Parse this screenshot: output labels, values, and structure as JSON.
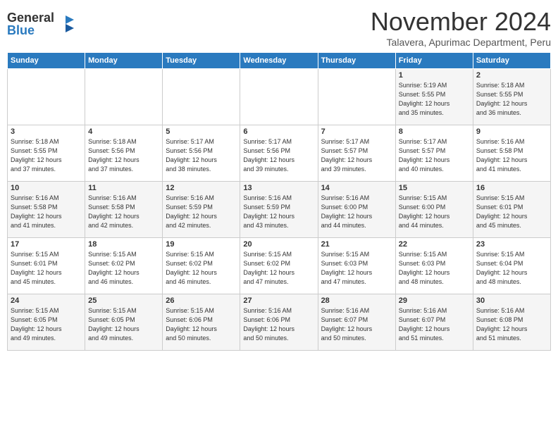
{
  "header": {
    "logo_general": "General",
    "logo_blue": "Blue",
    "month_title": "November 2024",
    "location": "Talavera, Apurimac Department, Peru"
  },
  "days_of_week": [
    "Sunday",
    "Monday",
    "Tuesday",
    "Wednesday",
    "Thursday",
    "Friday",
    "Saturday"
  ],
  "weeks": [
    [
      {
        "day": "",
        "info": ""
      },
      {
        "day": "",
        "info": ""
      },
      {
        "day": "",
        "info": ""
      },
      {
        "day": "",
        "info": ""
      },
      {
        "day": "",
        "info": ""
      },
      {
        "day": "1",
        "info": "Sunrise: 5:19 AM\nSunset: 5:55 PM\nDaylight: 12 hours\nand 35 minutes."
      },
      {
        "day": "2",
        "info": "Sunrise: 5:18 AM\nSunset: 5:55 PM\nDaylight: 12 hours\nand 36 minutes."
      }
    ],
    [
      {
        "day": "3",
        "info": "Sunrise: 5:18 AM\nSunset: 5:55 PM\nDaylight: 12 hours\nand 37 minutes."
      },
      {
        "day": "4",
        "info": "Sunrise: 5:18 AM\nSunset: 5:56 PM\nDaylight: 12 hours\nand 37 minutes."
      },
      {
        "day": "5",
        "info": "Sunrise: 5:17 AM\nSunset: 5:56 PM\nDaylight: 12 hours\nand 38 minutes."
      },
      {
        "day": "6",
        "info": "Sunrise: 5:17 AM\nSunset: 5:56 PM\nDaylight: 12 hours\nand 39 minutes."
      },
      {
        "day": "7",
        "info": "Sunrise: 5:17 AM\nSunset: 5:57 PM\nDaylight: 12 hours\nand 39 minutes."
      },
      {
        "day": "8",
        "info": "Sunrise: 5:17 AM\nSunset: 5:57 PM\nDaylight: 12 hours\nand 40 minutes."
      },
      {
        "day": "9",
        "info": "Sunrise: 5:16 AM\nSunset: 5:58 PM\nDaylight: 12 hours\nand 41 minutes."
      }
    ],
    [
      {
        "day": "10",
        "info": "Sunrise: 5:16 AM\nSunset: 5:58 PM\nDaylight: 12 hours\nand 41 minutes."
      },
      {
        "day": "11",
        "info": "Sunrise: 5:16 AM\nSunset: 5:58 PM\nDaylight: 12 hours\nand 42 minutes."
      },
      {
        "day": "12",
        "info": "Sunrise: 5:16 AM\nSunset: 5:59 PM\nDaylight: 12 hours\nand 42 minutes."
      },
      {
        "day": "13",
        "info": "Sunrise: 5:16 AM\nSunset: 5:59 PM\nDaylight: 12 hours\nand 43 minutes."
      },
      {
        "day": "14",
        "info": "Sunrise: 5:16 AM\nSunset: 6:00 PM\nDaylight: 12 hours\nand 44 minutes."
      },
      {
        "day": "15",
        "info": "Sunrise: 5:15 AM\nSunset: 6:00 PM\nDaylight: 12 hours\nand 44 minutes."
      },
      {
        "day": "16",
        "info": "Sunrise: 5:15 AM\nSunset: 6:01 PM\nDaylight: 12 hours\nand 45 minutes."
      }
    ],
    [
      {
        "day": "17",
        "info": "Sunrise: 5:15 AM\nSunset: 6:01 PM\nDaylight: 12 hours\nand 45 minutes."
      },
      {
        "day": "18",
        "info": "Sunrise: 5:15 AM\nSunset: 6:02 PM\nDaylight: 12 hours\nand 46 minutes."
      },
      {
        "day": "19",
        "info": "Sunrise: 5:15 AM\nSunset: 6:02 PM\nDaylight: 12 hours\nand 46 minutes."
      },
      {
        "day": "20",
        "info": "Sunrise: 5:15 AM\nSunset: 6:02 PM\nDaylight: 12 hours\nand 47 minutes."
      },
      {
        "day": "21",
        "info": "Sunrise: 5:15 AM\nSunset: 6:03 PM\nDaylight: 12 hours\nand 47 minutes."
      },
      {
        "day": "22",
        "info": "Sunrise: 5:15 AM\nSunset: 6:03 PM\nDaylight: 12 hours\nand 48 minutes."
      },
      {
        "day": "23",
        "info": "Sunrise: 5:15 AM\nSunset: 6:04 PM\nDaylight: 12 hours\nand 48 minutes."
      }
    ],
    [
      {
        "day": "24",
        "info": "Sunrise: 5:15 AM\nSunset: 6:05 PM\nDaylight: 12 hours\nand 49 minutes."
      },
      {
        "day": "25",
        "info": "Sunrise: 5:15 AM\nSunset: 6:05 PM\nDaylight: 12 hours\nand 49 minutes."
      },
      {
        "day": "26",
        "info": "Sunrise: 5:15 AM\nSunset: 6:06 PM\nDaylight: 12 hours\nand 50 minutes."
      },
      {
        "day": "27",
        "info": "Sunrise: 5:16 AM\nSunset: 6:06 PM\nDaylight: 12 hours\nand 50 minutes."
      },
      {
        "day": "28",
        "info": "Sunrise: 5:16 AM\nSunset: 6:07 PM\nDaylight: 12 hours\nand 50 minutes."
      },
      {
        "day": "29",
        "info": "Sunrise: 5:16 AM\nSunset: 6:07 PM\nDaylight: 12 hours\nand 51 minutes."
      },
      {
        "day": "30",
        "info": "Sunrise: 5:16 AM\nSunset: 6:08 PM\nDaylight: 12 hours\nand 51 minutes."
      }
    ]
  ]
}
